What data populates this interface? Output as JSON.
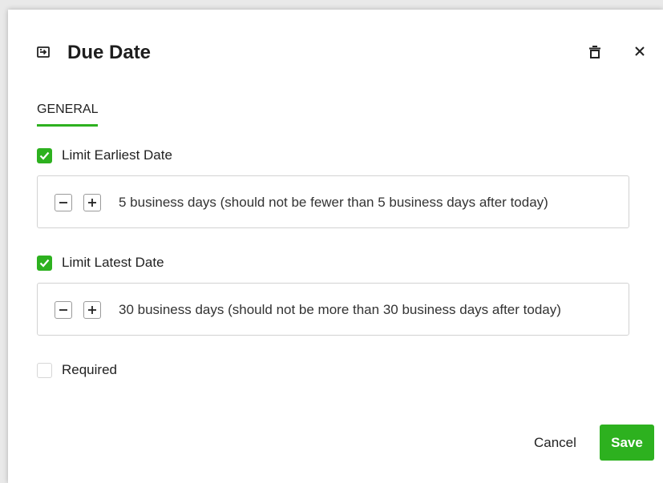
{
  "dialog": {
    "title": "Due Date",
    "header_icon": "field-input-icon",
    "delete_icon": "trash-icon",
    "close_icon": "close-icon"
  },
  "tabs": [
    {
      "label": "GENERAL",
      "active": true
    }
  ],
  "options": {
    "limit_earliest": {
      "label": "Limit Earliest Date",
      "checked": true,
      "value_text": "5 business days (should not be fewer than 5 business days after today)"
    },
    "limit_latest": {
      "label": "Limit Latest Date",
      "checked": true,
      "value_text": "30 business days (should not be more than 30 business days after today)"
    },
    "required": {
      "label": "Required",
      "checked": false
    }
  },
  "footer": {
    "cancel_label": "Cancel",
    "save_label": "Save"
  },
  "colors": {
    "accent": "#2db11f",
    "border": "#d2d2d2",
    "text": "#222222"
  }
}
